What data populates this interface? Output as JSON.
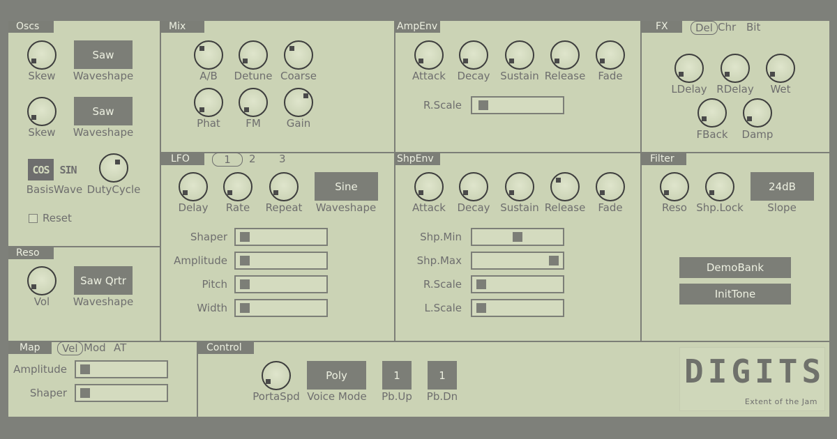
{
  "oscs": {
    "title": "Oscs",
    "osc1": {
      "skew_label": "Skew",
      "waveshape_value": "Saw",
      "waveshape_label": "Waveshape"
    },
    "osc2": {
      "skew_label": "Skew",
      "waveshape_value": "Saw",
      "waveshape_label": "Waveshape"
    },
    "basis_cos": "COS",
    "basis_sin": "SIN",
    "basis_label": "BasisWave",
    "duty_label": "DutyCycle",
    "reset_label": "Reset"
  },
  "reso": {
    "title": "Reso",
    "vol_label": "Vol",
    "waveshape_value": "Saw Qrtr",
    "waveshape_label": "Waveshape"
  },
  "mix": {
    "title": "Mix",
    "knobs": [
      "A/B",
      "Detune",
      "Coarse",
      "Phat",
      "FM",
      "Gain"
    ]
  },
  "ampenv": {
    "title": "AmpEnv",
    "knobs": [
      "Attack",
      "Decay",
      "Sustain",
      "Release",
      "Fade"
    ],
    "rscale_label": "R.Scale",
    "rscale_value": 0.05
  },
  "fx": {
    "title": "FX",
    "tabs": [
      "Del",
      "Chr",
      "Bit"
    ],
    "selected_tab": "Del",
    "knobs": [
      "LDelay",
      "RDelay",
      "Wet",
      "FBack",
      "Damp"
    ]
  },
  "lfo": {
    "title": "LFO",
    "tabs": [
      "1",
      "2",
      "3"
    ],
    "selected_tab": "1",
    "knobs": [
      "Delay",
      "Rate",
      "Repeat"
    ],
    "waveshape_value": "Sine",
    "waveshape_label": "Waveshape",
    "sliders": [
      {
        "label": "Shaper",
        "value": 0.02
      },
      {
        "label": "Amplitude",
        "value": 0.02
      },
      {
        "label": "Pitch",
        "value": 0.02
      },
      {
        "label": "Width",
        "value": 0.02
      }
    ]
  },
  "shpenv": {
    "title": "ShpEnv",
    "knobs": [
      "Attack",
      "Decay",
      "Sustain",
      "Release",
      "Fade"
    ],
    "sliders": [
      {
        "label": "Shp.Min",
        "value": 0.5
      },
      {
        "label": "Shp.Max",
        "value": 0.98
      },
      {
        "label": "R.Scale",
        "value": 0.02
      },
      {
        "label": "L.Scale",
        "value": 0.02
      }
    ]
  },
  "filter": {
    "title": "Filter",
    "reso_label": "Reso",
    "shplock_label": "Shp.Lock",
    "slope_value": "24dB",
    "slope_label": "Slope",
    "demobank_label": "DemoBank",
    "inittone_label": "InitTone"
  },
  "map": {
    "title": "Map",
    "tabs": [
      "Vel",
      "Mod",
      "AT"
    ],
    "selected_tab": "Vel",
    "sliders": [
      {
        "label": "Amplitude",
        "value": 0.02
      },
      {
        "label": "Shaper",
        "value": 0.02
      }
    ]
  },
  "control": {
    "title": "Control",
    "portaspd_label": "PortaSpd",
    "voice_mode_value": "Poly",
    "voice_mode_label": "Voice Mode",
    "pbup_value": "1",
    "pbup_label": "Pb.Up",
    "pbdn_value": "1",
    "pbdn_label": "Pb.Dn"
  },
  "logo": {
    "text": "DIGITS",
    "tagline": "Extent of the Jam"
  },
  "colors": {
    "panel_bg": "#cbd3b5",
    "frame": "#7c7e77",
    "text": "#6e6e6e",
    "button_text": "#edf0e1"
  }
}
